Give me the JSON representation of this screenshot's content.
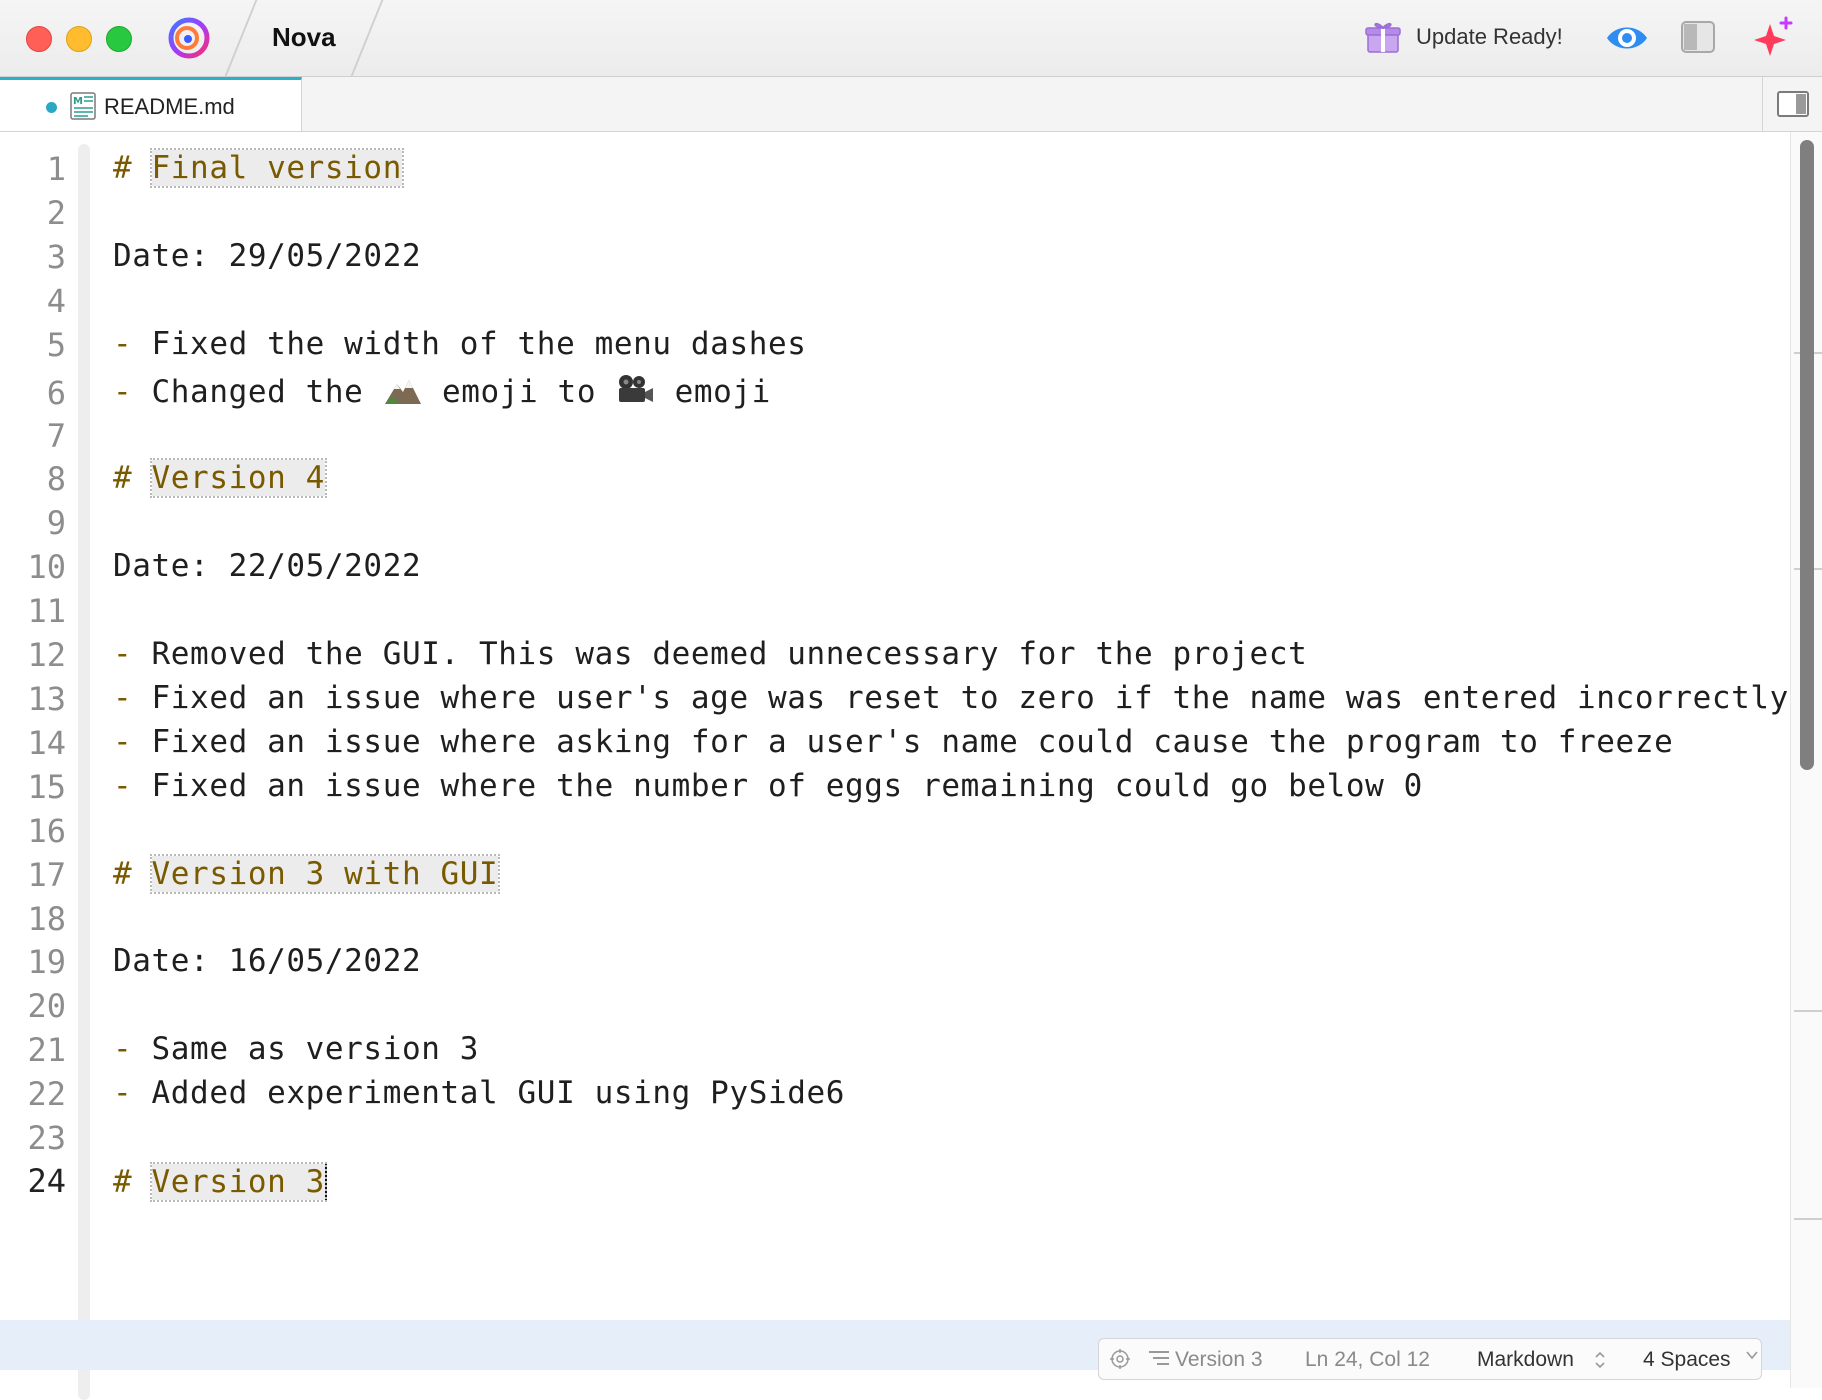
{
  "window": {
    "project_name": "Nova",
    "update_label": "Update Ready!",
    "icons": [
      "app-logo-icon",
      "gift-icon",
      "eye-icon",
      "sidebar-toggle-icon",
      "sparkle-plus-icon"
    ]
  },
  "tabs": [
    {
      "label": "README.md",
      "modified": true,
      "icon": "markdown-file-icon"
    }
  ],
  "editor": {
    "lines": [
      {
        "n": "1",
        "kind": "heading",
        "hash": "#",
        "text": "Final version"
      },
      {
        "n": "2",
        "kind": "blank"
      },
      {
        "n": "3",
        "kind": "text",
        "text": "Date: 29/05/2022"
      },
      {
        "n": "4",
        "kind": "blank"
      },
      {
        "n": "5",
        "kind": "bullet",
        "text": "Fixed the width of the menu dashes"
      },
      {
        "n": "6",
        "kind": "emoji-bullet",
        "before": "Changed the",
        "mid": "emoji to",
        "after": "emoji",
        "emoji1": "mountain-emoji",
        "emoji2": "movie-camera-emoji"
      },
      {
        "n": "7",
        "kind": "blank"
      },
      {
        "n": "8",
        "kind": "heading",
        "hash": "#",
        "text": "Version 4"
      },
      {
        "n": "9",
        "kind": "blank"
      },
      {
        "n": "10",
        "kind": "text",
        "text": "Date: 22/05/2022"
      },
      {
        "n": "11",
        "kind": "blank"
      },
      {
        "n": "12",
        "kind": "bullet",
        "text": "Removed the GUI. This was deemed unnecessary for the project"
      },
      {
        "n": "13",
        "kind": "bullet",
        "text": "Fixed an issue where user's age was reset to zero if the name was entered incorrectly"
      },
      {
        "n": "14",
        "kind": "bullet",
        "text": "Fixed an issue where asking for a user's name could cause the program to freeze"
      },
      {
        "n": "15",
        "kind": "bullet",
        "text": "Fixed an issue where the number of eggs remaining could go below 0"
      },
      {
        "n": "16",
        "kind": "blank"
      },
      {
        "n": "17",
        "kind": "heading",
        "hash": "#",
        "text": "Version 3 with GUI"
      },
      {
        "n": "18",
        "kind": "blank"
      },
      {
        "n": "19",
        "kind": "text",
        "text": "Date: 16/05/2022"
      },
      {
        "n": "20",
        "kind": "blank"
      },
      {
        "n": "21",
        "kind": "bullet",
        "text": "Same as version 3"
      },
      {
        "n": "22",
        "kind": "bullet",
        "text": "Added experimental GUI using PySide6"
      },
      {
        "n": "23",
        "kind": "blank"
      },
      {
        "n": "24",
        "kind": "heading",
        "hash": "#",
        "text": "Version 3",
        "active": true
      }
    ],
    "bullet_marker": "-"
  },
  "status": {
    "symbol": "Version 3",
    "position": "Ln 24, Col 12",
    "language": "Markdown",
    "indent": "4 Spaces"
  },
  "colors": {
    "accent": "#29b1c6",
    "heading": "#7a5a00",
    "current_line": "#e6eef9"
  }
}
